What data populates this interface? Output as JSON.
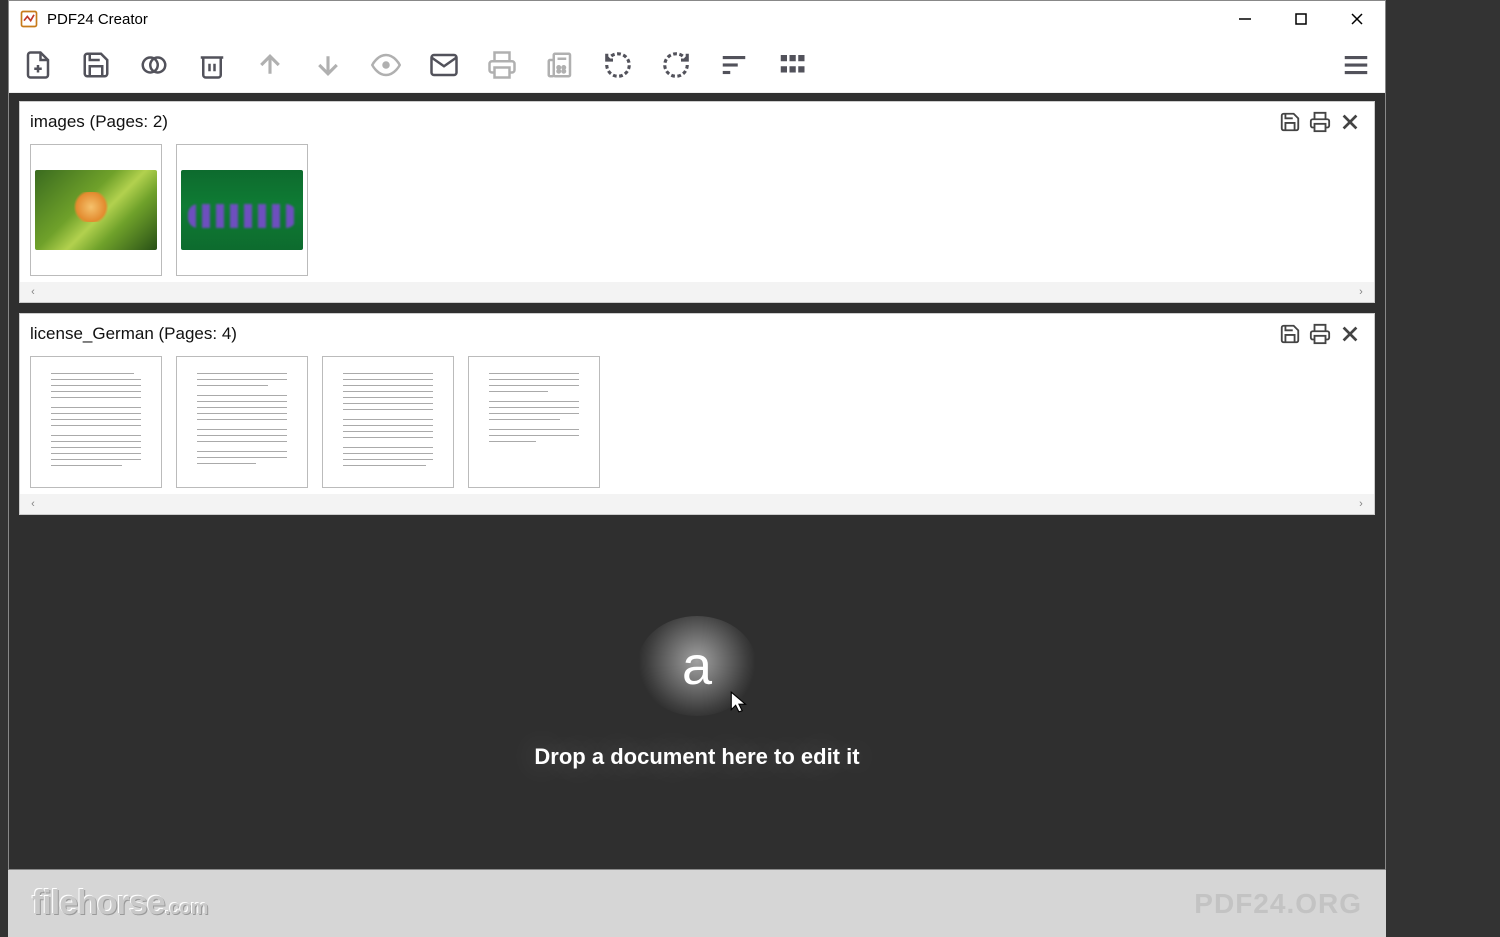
{
  "window": {
    "title": "PDF24 Creator"
  },
  "toolbar": {
    "add": "add-file",
    "save": "save",
    "merge": "merge",
    "delete": "delete",
    "up": "move-up",
    "down": "move-down",
    "preview": "preview",
    "email": "email",
    "print": "print",
    "fax": "fax",
    "rotateL": "rotate-left",
    "rotateR": "rotate-right",
    "sort": "sort",
    "grid": "grid-view",
    "menu": "menu"
  },
  "documents": [
    {
      "name": "images",
      "pages_label": "(Pages: 2)",
      "page_count": 2,
      "thumbs": [
        "image-flower",
        "image-purple-flowers"
      ]
    },
    {
      "name": "license_German",
      "pages_label": "(Pages: 4)",
      "page_count": 4,
      "thumbs": [
        "text-page-1",
        "text-page-2",
        "text-page-3",
        "text-page-4"
      ]
    }
  ],
  "dropzone": {
    "hint": "Drop a document here to edit it"
  },
  "footer": {
    "left_brand": "filehorse",
    "left_ext": ".com",
    "right_brand": "PDF24.ORG"
  }
}
